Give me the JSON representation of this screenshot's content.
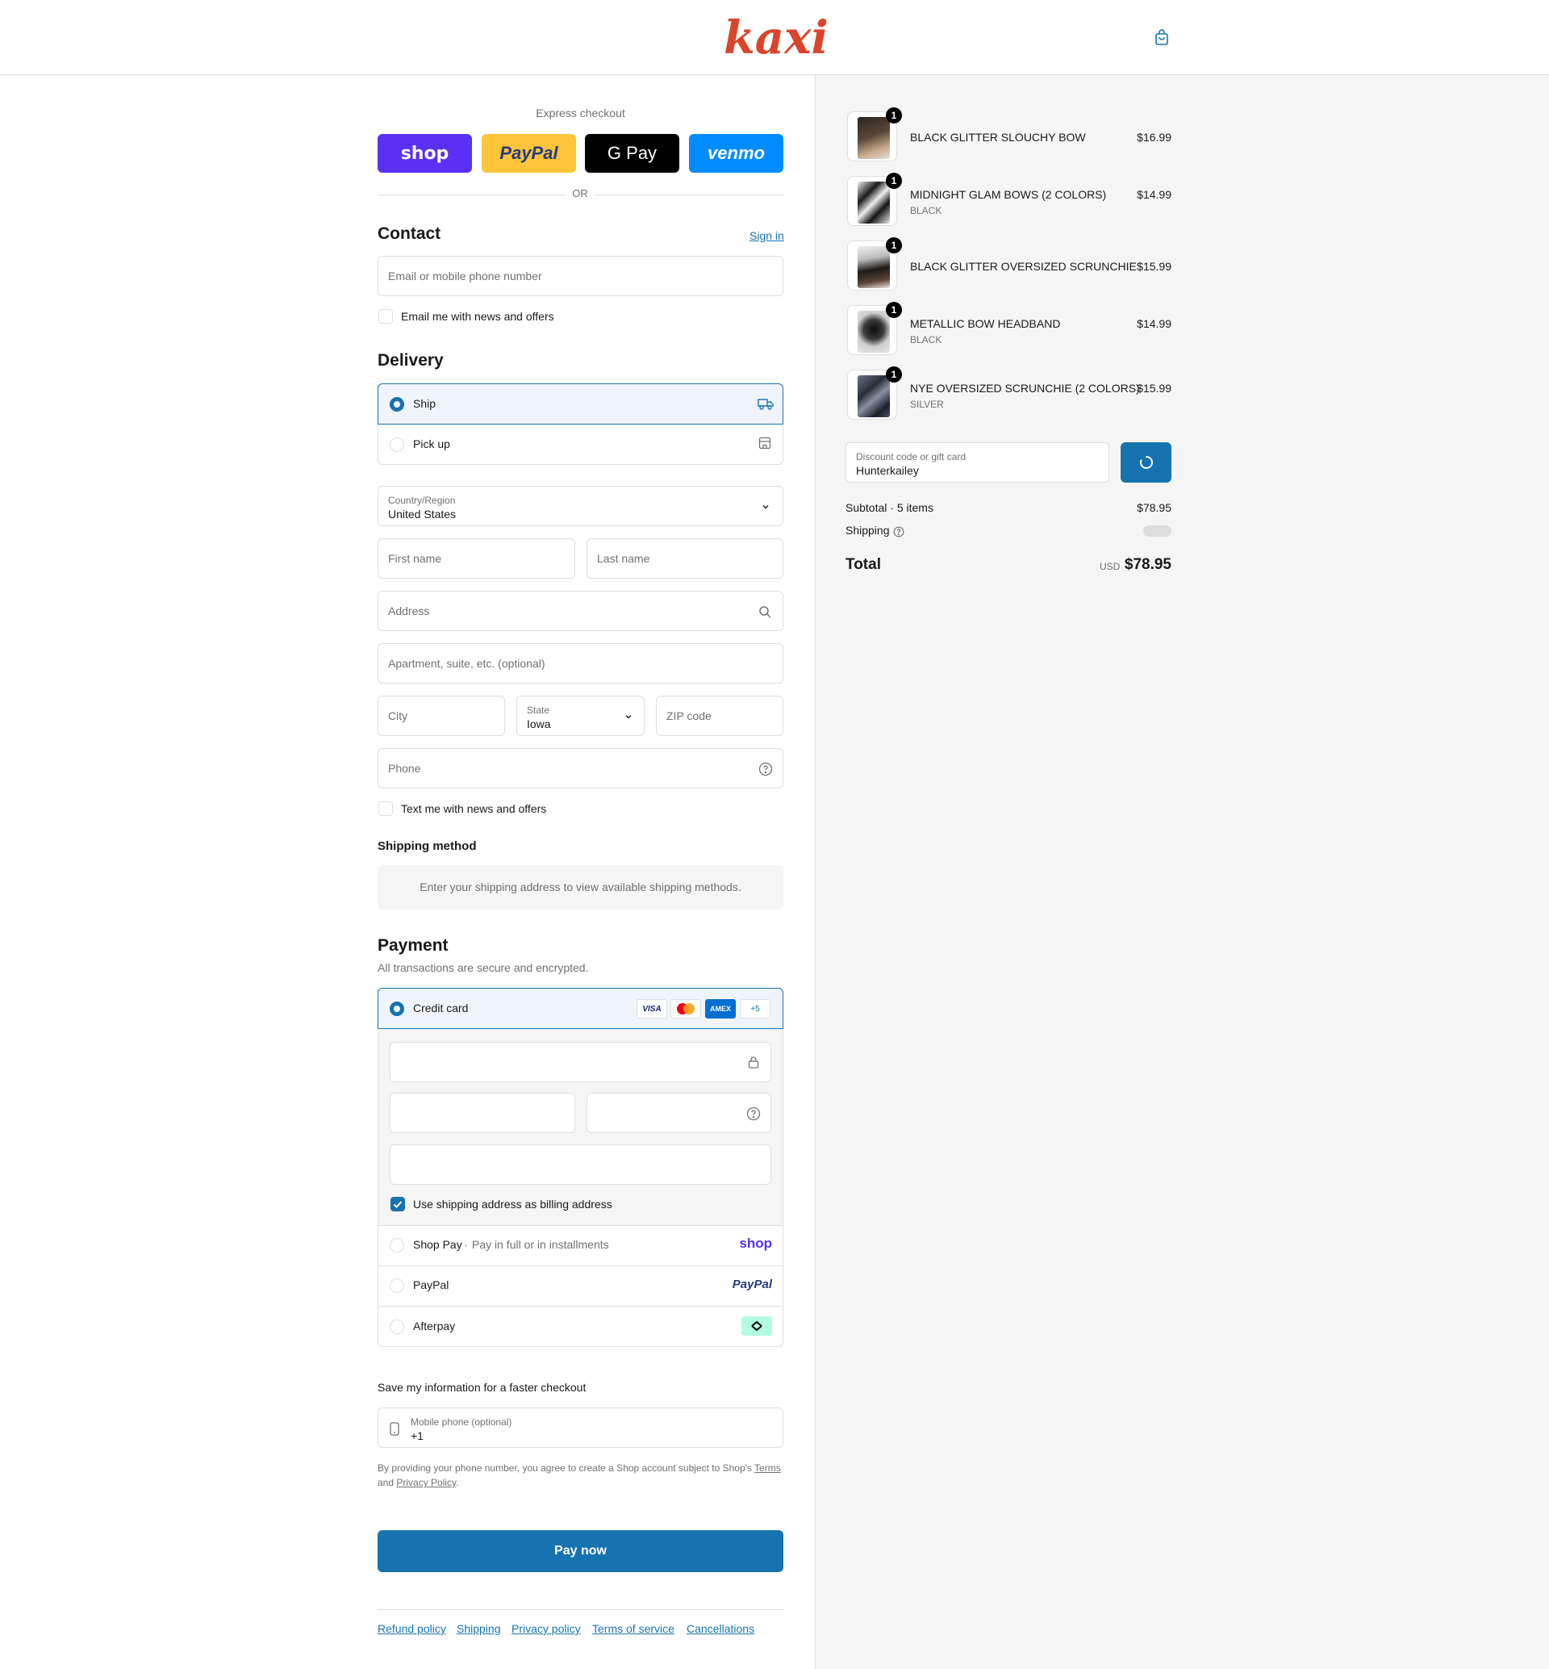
{
  "header": {
    "logo_text": "kaxi.",
    "cart_icon": "shopping-bag-icon"
  },
  "express": {
    "title": "Express checkout",
    "buttons": [
      "shop",
      "PayPal",
      "G Pay",
      "venmo"
    ],
    "or": "OR"
  },
  "contact": {
    "title": "Contact",
    "sign_in": "Sign in",
    "email_placeholder": "Email or mobile phone number",
    "news_checkbox": "Email me with news and offers"
  },
  "delivery": {
    "title": "Delivery",
    "options": [
      {
        "label": "Ship",
        "selected": true,
        "icon": "truck-icon"
      },
      {
        "label": "Pick up",
        "selected": false,
        "icon": "store-icon"
      }
    ],
    "country_label": "Country/Region",
    "country_value": "United States",
    "first_name": "First name",
    "last_name": "Last name",
    "address": "Address",
    "apartment": "Apartment, suite, etc. (optional)",
    "city": "City",
    "state_label": "State",
    "state_value": "Iowa",
    "zip": "ZIP code",
    "phone": "Phone",
    "text_checkbox": "Text me with news and offers"
  },
  "shipping_method": {
    "title": "Shipping method",
    "notice": "Enter your shipping address to view available shipping methods."
  },
  "payment": {
    "title": "Payment",
    "subtitle": "All transactions are secure and encrypted.",
    "credit_card_label": "Credit card",
    "card_icons": [
      "VISA",
      "mastercard",
      "AMEX",
      "+5"
    ],
    "billing_checkbox": "Use shipping address as billing address",
    "shop_pay": "Shop Pay",
    "shop_pay_note": "Pay in full or in installments",
    "shop_pay_logo": "shop",
    "paypal": "PayPal",
    "paypal_logo": "PayPal",
    "afterpay": "Afterpay"
  },
  "save_info": {
    "title": "Save my information for a faster checkout",
    "mobile_label": "Mobile phone (optional)",
    "mobile_value": "+1",
    "disclaimer_1": "By providing your phone number, you agree to create a Shop account subject to Shop's",
    "terms": "Terms",
    "and": "and",
    "privacy": "Privacy Policy",
    "period": "."
  },
  "pay_now": "Pay now",
  "footer_links": [
    "Refund policy",
    "Shipping",
    "Privacy policy",
    "Terms of service",
    "Cancellations"
  ],
  "summary": {
    "items": [
      {
        "name": "BLACK GLITTER SLOUCHY BOW",
        "variant": "",
        "price": "$16.99",
        "qty": "1"
      },
      {
        "name": "MIDNIGHT GLAM BOWS (2 COLORS)",
        "variant": "BLACK",
        "price": "$14.99",
        "qty": "1"
      },
      {
        "name": "BLACK GLITTER OVERSIZED SCRUNCHIE",
        "variant": "",
        "price": "$15.99",
        "qty": "1"
      },
      {
        "name": "METALLIC BOW HEADBAND",
        "variant": "BLACK",
        "price": "$14.99",
        "qty": "1"
      },
      {
        "name": "NYE OVERSIZED SCRUNCHIE (2 COLORS)",
        "variant": "SILVER",
        "price": "$15.99",
        "qty": "1"
      }
    ],
    "discount_label": "Discount code or gift card",
    "discount_value": "Hunterkailey",
    "subtotal_label": "Subtotal · 5 items",
    "subtotal_value": "$78.95",
    "shipping_label": "Shipping",
    "total_label": "Total",
    "currency": "USD",
    "total_value": "$78.95"
  },
  "colors": {
    "accent": "#1773b0",
    "shop": "#5a31f4",
    "paypal": "#ffc439",
    "venmo": "#008cff",
    "logo": "#d9452b"
  }
}
